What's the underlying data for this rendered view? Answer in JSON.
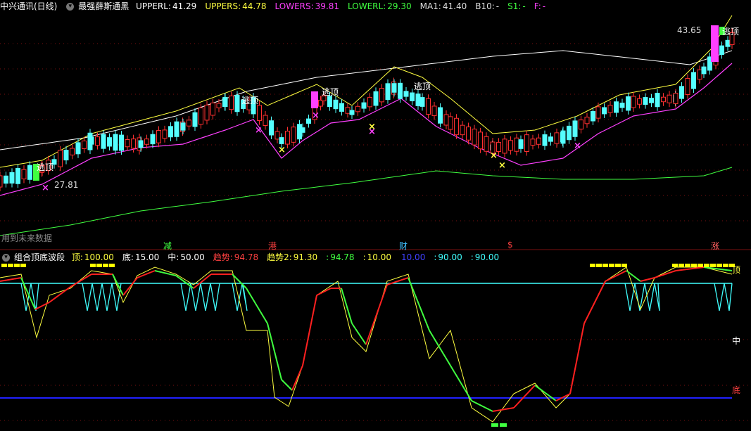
{
  "top_panel": {
    "stock": "中兴通讯(日线)",
    "indicator": "最强薛斯通黑",
    "fields": [
      {
        "label": "UPPERL:",
        "value": "41.29",
        "color": "#ffffff"
      },
      {
        "label": "UPPERS:",
        "value": "44.78",
        "color": "#ffff40"
      },
      {
        "label": "LOWERS:",
        "value": "39.81",
        "color": "#ff40ff"
      },
      {
        "label": "LOWERL:",
        "value": "29.30",
        "color": "#40ff40"
      },
      {
        "label": "MA1:",
        "value": "41.40",
        "color": "#dddddd"
      },
      {
        "label": "B10:",
        "value": "-",
        "color": "#dddddd"
      },
      {
        "label": "S1:",
        "value": "-",
        "color": "#40ff40"
      },
      {
        "label": "F:",
        "value": "-",
        "color": "#ff40ff"
      }
    ],
    "price_high": "43.65",
    "price_low": "27.81",
    "escape_label": "逃顶",
    "future_note": "用到未来数据",
    "markers": [
      {
        "text": "减",
        "color": "#40ff40"
      },
      {
        "text": "港",
        "color": "#ff4040"
      },
      {
        "text": "财",
        "color": "#40c0ff"
      },
      {
        "text": "$",
        "color": "#ff4040"
      },
      {
        "text": "涨",
        "color": "#ff6060"
      }
    ]
  },
  "bottom_panel": {
    "indicator": "组合顶底波段",
    "fields": [
      {
        "label": "顶:",
        "value": "100.00",
        "color": "#ffff40"
      },
      {
        "label": "底:",
        "value": "15.00",
        "color": "#ffffff"
      },
      {
        "label": "中:",
        "value": "50.00",
        "color": "#ffffff"
      },
      {
        "label": "趋势:",
        "value": "94.78",
        "color": "#ff4040"
      },
      {
        "label": "趋势2:",
        "value": "91.30",
        "color": "#ffff40"
      },
      {
        "label": ":",
        "value": "94.78",
        "color": "#40ff40"
      },
      {
        "label": ":",
        "value": "10.00",
        "color": "#ffff40"
      },
      {
        "label": "",
        "value": "10.00",
        "color": "#4040ff"
      },
      {
        "label": ":",
        "value": "90.00",
        "color": "#40ffff"
      },
      {
        "label": ":",
        "value": "90.00",
        "color": "#40ffff"
      }
    ],
    "axis_labels": {
      "top": "顶",
      "mid": "中",
      "bottom": "底"
    }
  }
}
